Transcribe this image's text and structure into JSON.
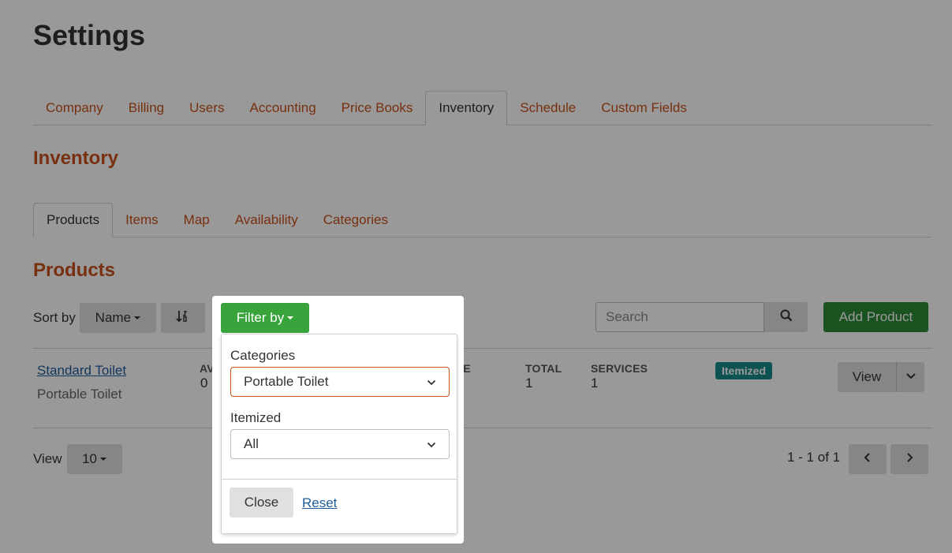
{
  "page": {
    "title": "Settings"
  },
  "main_tabs": [
    {
      "label": "Company"
    },
    {
      "label": "Billing"
    },
    {
      "label": "Users"
    },
    {
      "label": "Accounting"
    },
    {
      "label": "Price Books"
    },
    {
      "label": "Inventory",
      "active": true
    },
    {
      "label": "Schedule"
    },
    {
      "label": "Custom Fields"
    }
  ],
  "inventory": {
    "title": "Inventory"
  },
  "sub_tabs": [
    {
      "label": "Products",
      "active": true
    },
    {
      "label": "Items"
    },
    {
      "label": "Map"
    },
    {
      "label": "Availability"
    },
    {
      "label": "Categories"
    }
  ],
  "products": {
    "title": "Products",
    "sort_label": "Sort by",
    "sort_value": "Name",
    "sort_dir_icon": "sort-amount-icon",
    "search_placeholder": "Search",
    "add_button": "Add Product"
  },
  "row": {
    "name": "Standard Toilet",
    "category": "Portable Toilet",
    "available_label_partial": "AVA",
    "available_value": "0",
    "price_label_partial": "CE",
    "total_label": "TOTAL",
    "total_value": "1",
    "services_label": "SERVICES",
    "services_value": "1",
    "badge": "Itemized",
    "view_button": "View"
  },
  "footer": {
    "view_label": "View",
    "per_page": "10",
    "range": "1 - 1 of 1"
  },
  "filter": {
    "button": "Filter by",
    "categories_label": "Categories",
    "categories_value": "Portable Toilet",
    "itemized_label": "Itemized",
    "itemized_value": "All",
    "close_button": "Close",
    "reset_link": "Reset"
  },
  "colors": {
    "accent": "#c8501c",
    "add_green": "#2e8b36",
    "filter_green": "#3aa43c",
    "badge_teal": "#178a88",
    "link": "#1f5c99"
  }
}
